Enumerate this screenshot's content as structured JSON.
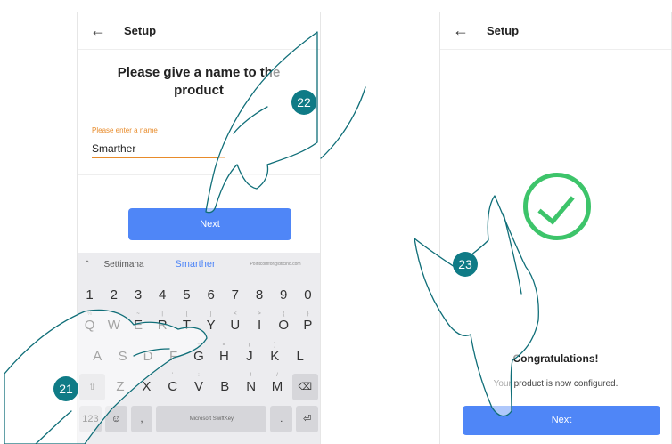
{
  "left_screen": {
    "header": {
      "back_icon": "back-arrow-icon",
      "title": "Setup"
    },
    "prompt": "Please give a name to the product",
    "input": {
      "label": "Please enter a name",
      "value": "Smarther"
    },
    "next_label": "Next",
    "keyboard": {
      "suggestions": [
        "Settimana",
        "Smarther",
        "Pointcomfor@bticino.com"
      ],
      "number_row": [
        "1",
        "2",
        "3",
        "4",
        "5",
        "6",
        "7",
        "8",
        "9",
        "0"
      ],
      "q_row": [
        {
          "k": "Q",
          "s": "%"
        },
        {
          "k": "W",
          "s": "^"
        },
        {
          "k": "E",
          "s": "~"
        },
        {
          "k": "R",
          "s": "|"
        },
        {
          "k": "T",
          "s": "["
        },
        {
          "k": "Y",
          "s": "]"
        },
        {
          "k": "U",
          "s": "<"
        },
        {
          "k": "I",
          "s": ">"
        },
        {
          "k": "O",
          "s": "{"
        },
        {
          "k": "P",
          "s": "}"
        }
      ],
      "a_row": [
        {
          "k": "A",
          "s": ""
        },
        {
          "k": "S",
          "s": ""
        },
        {
          "k": "D",
          "s": ""
        },
        {
          "k": "F",
          "s": ""
        },
        {
          "k": "G",
          "s": "+"
        },
        {
          "k": "H",
          "s": "="
        },
        {
          "k": "J",
          "s": "("
        },
        {
          "k": "K",
          "s": ")"
        },
        {
          "k": "L",
          "s": ""
        }
      ],
      "z_row": [
        {
          "k": "Z",
          "s": ""
        },
        {
          "k": "X",
          "s": ""
        },
        {
          "k": "C",
          "s": "'"
        },
        {
          "k": "V",
          "s": ":"
        },
        {
          "k": "B",
          "s": ";"
        },
        {
          "k": "N",
          "s": "!"
        },
        {
          "k": "M",
          "s": "/"
        }
      ],
      "symbols_label": "123",
      "space_label": "Microsoft SwiftKey",
      "period_label": ".",
      "enter_icon": "enter-icon",
      "shift_icon": "shift-icon",
      "backspace_icon": "backspace-icon"
    }
  },
  "right_screen": {
    "header": {
      "back_icon": "back-arrow-icon",
      "title": "Setup"
    },
    "success_icon": "checkmark-circle-icon",
    "congrats": "Congratulations!",
    "message": "Your product is now configured.",
    "next_label": "Next"
  },
  "step_badges": {
    "step_a": "22",
    "step_b": "21",
    "step_c": "23"
  },
  "colors": {
    "accent_blue": "#4f86f7",
    "accent_orange": "#e88b2a",
    "success_green": "#3dc46a",
    "badge_teal": "#0f7b86"
  }
}
